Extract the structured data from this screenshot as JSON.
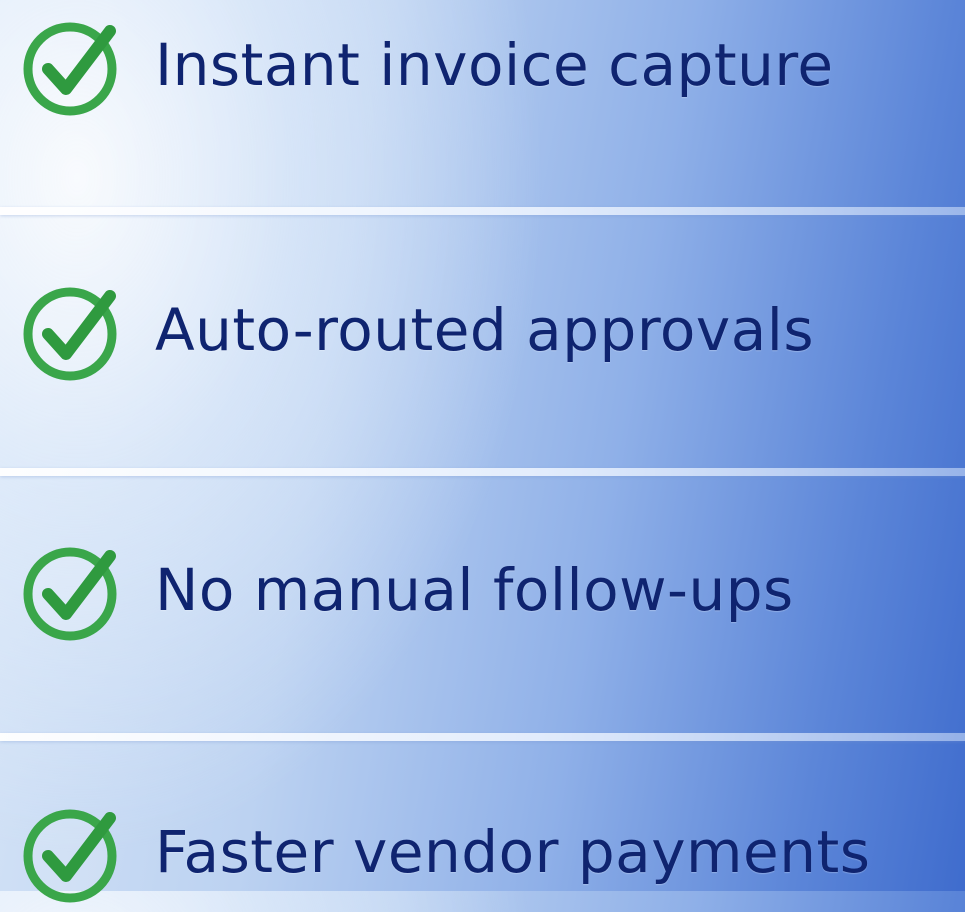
{
  "colors": {
    "text": "#0f2470",
    "check_green": "#3aa64a",
    "divider": "#f4f8ff"
  },
  "features": [
    {
      "icon": "check-circle-icon",
      "label": "Instant invoice capture"
    },
    {
      "icon": "check-circle-icon",
      "label": "Auto-routed approvals"
    },
    {
      "icon": "check-circle-icon",
      "label": "No manual follow-ups"
    },
    {
      "icon": "check-circle-icon",
      "label": "Faster vendor payments"
    }
  ]
}
